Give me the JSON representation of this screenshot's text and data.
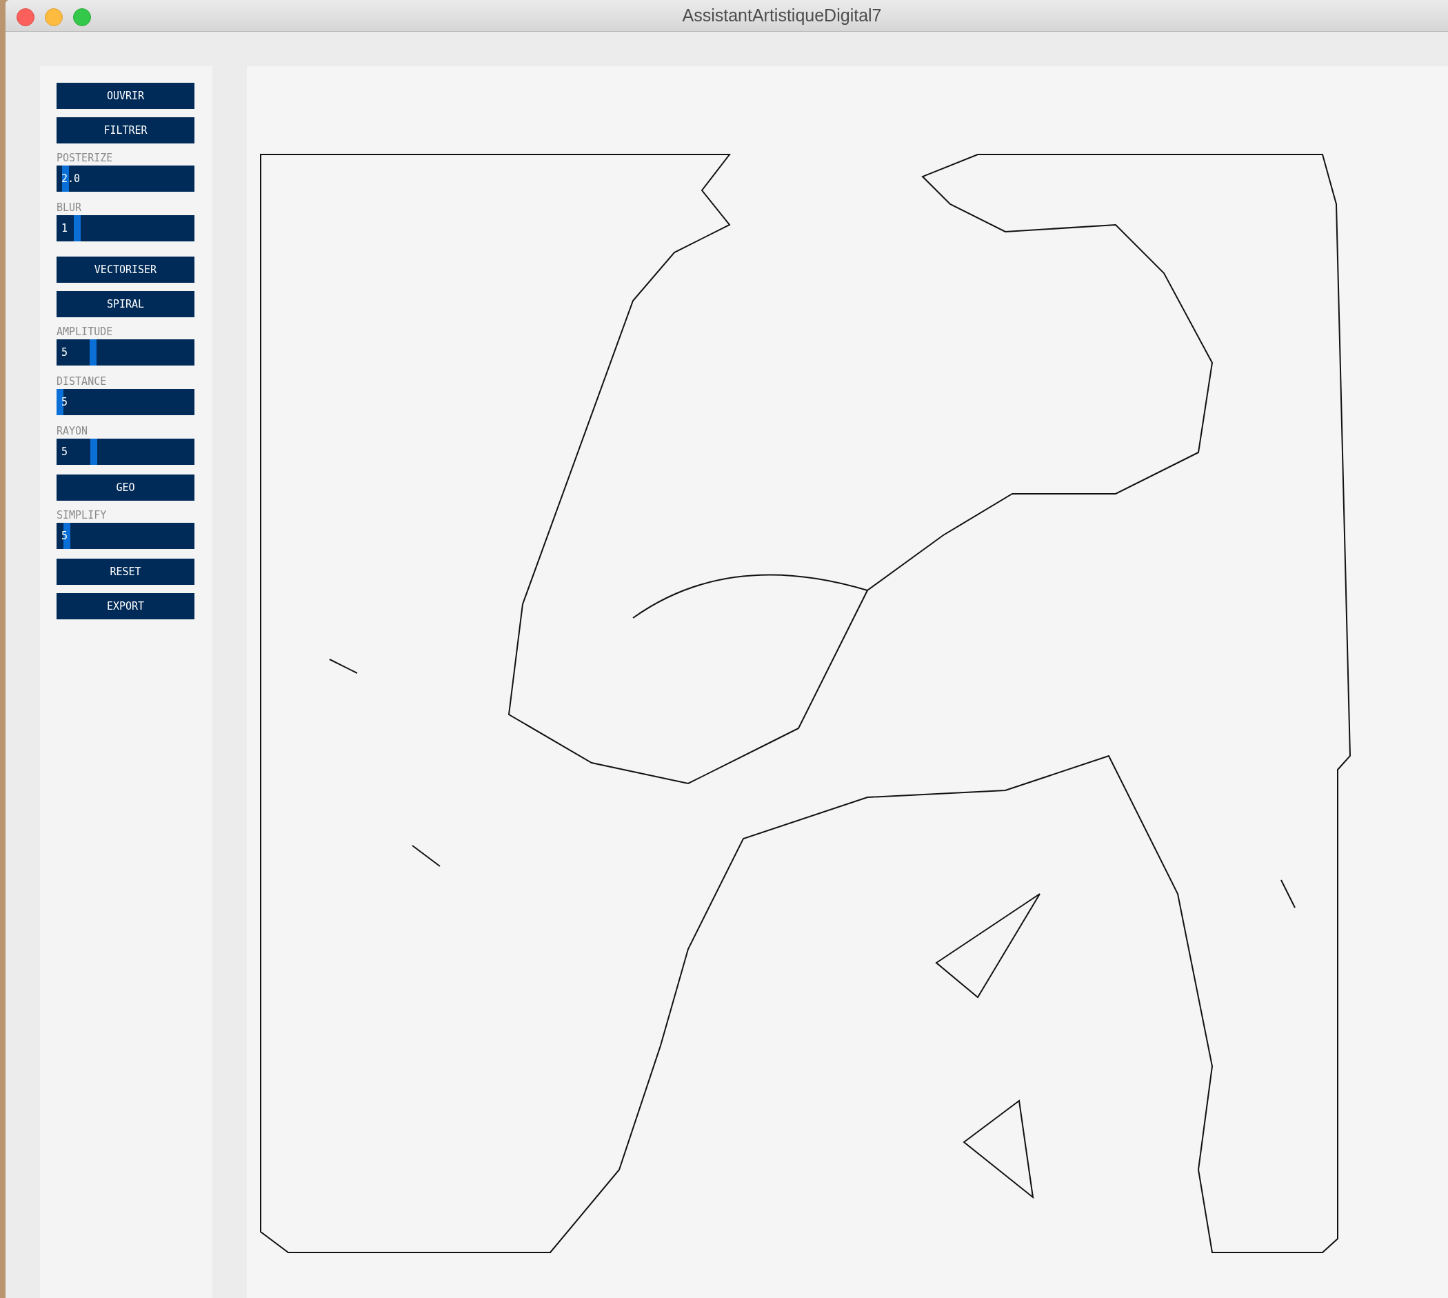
{
  "window": {
    "title": "AssistantArtistiqueDigital7"
  },
  "controls": [
    {
      "kind": "button",
      "label": "OUVRIR"
    },
    {
      "kind": "button",
      "label": "FILTRER"
    },
    {
      "kind": "slider",
      "label": "POSTERIZE",
      "value": "2.0",
      "level": 0.04
    },
    {
      "kind": "slider",
      "label": "BLUR",
      "value": "1",
      "level": 0.13
    },
    {
      "kind": "gap"
    },
    {
      "kind": "button",
      "label": "VECTORISER"
    },
    {
      "kind": "button",
      "label": "SPIRAL"
    },
    {
      "kind": "slider",
      "label": "AMPLITUDE",
      "value": "5",
      "level": 0.25
    },
    {
      "kind": "slider",
      "label": "DISTANCE",
      "value": "5",
      "level": 0.0
    },
    {
      "kind": "slider",
      "label": "RAYON",
      "value": "5",
      "level": 0.26
    },
    {
      "kind": "button",
      "label": "GEO"
    },
    {
      "kind": "slider",
      "label": "SIMPLIFY",
      "value": "5",
      "level": 0.05
    },
    {
      "kind": "button",
      "label": "RESET"
    },
    {
      "kind": "button",
      "label": "EXPORT"
    }
  ]
}
